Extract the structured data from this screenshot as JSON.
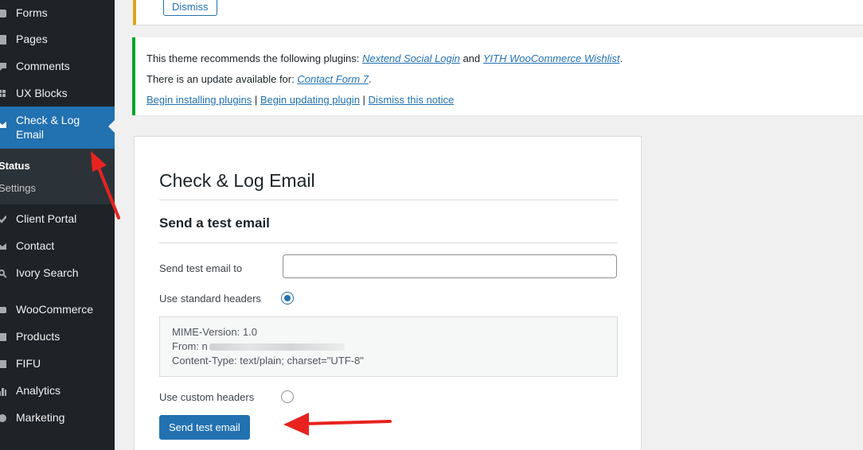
{
  "sidebar": {
    "items": [
      {
        "label": "Forms",
        "icon": "forms-icon"
      },
      {
        "label": "Pages",
        "icon": "pages-icon"
      },
      {
        "label": "Comments",
        "icon": "comments-icon"
      },
      {
        "label": "UX Blocks",
        "icon": "ux-blocks-icon"
      },
      {
        "label": "Check & Log Email",
        "icon": "email-icon"
      },
      {
        "label": "Client Portal",
        "icon": "client-portal-icon"
      },
      {
        "label": "Contact",
        "icon": "contact-icon"
      },
      {
        "label": "Ivory Search",
        "icon": "search-icon"
      },
      {
        "label": "WooCommerce",
        "icon": "woocommerce-icon"
      },
      {
        "label": "Products",
        "icon": "products-icon"
      },
      {
        "label": "FIFU",
        "icon": "fifu-icon"
      },
      {
        "label": "Analytics",
        "icon": "analytics-icon"
      },
      {
        "label": "Marketing",
        "icon": "marketing-icon"
      }
    ],
    "submenu": [
      "Status",
      "Settings"
    ],
    "active_color": "#2271b1",
    "background": "#1d2327"
  },
  "notice_top": {
    "dismiss_label": "Dismiss"
  },
  "notice_plugins": {
    "line1_prefix": "This theme recommends the following plugins: ",
    "plugin1": "Nextend Social Login",
    "line1_and": " and ",
    "plugin2": "YITH WooCommerce Wishlist",
    "line1_suffix": ".",
    "line2_prefix": "There is an update available for: ",
    "update_plugin": "Contact Form 7",
    "line2_suffix": ".",
    "link_install": "Begin installing plugins",
    "sep": " | ",
    "link_update": "Begin updating plugin",
    "link_dismiss": "Dismiss this notice"
  },
  "main": {
    "title": "Check & Log Email",
    "section_title": "Send a test email",
    "to_label": "Send test email to",
    "to_value": "",
    "standard_headers_label": "Use standard headers",
    "standard_headers_checked": true,
    "headers_lines": [
      "MIME-Version: 1.0",
      "From: n",
      "Content-Type: text/plain; charset=\"UTF-8\""
    ],
    "custom_headers_label": "Use custom headers",
    "custom_headers_checked": false,
    "send_button": "Send test email"
  },
  "colors": {
    "accent": "#2271b1",
    "notice_success": "#00a32a",
    "notice_warning": "#dba617",
    "annotation_arrow": "#e8231f"
  }
}
